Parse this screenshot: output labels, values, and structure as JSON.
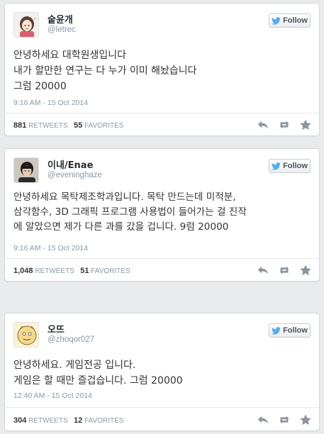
{
  "colors": {
    "background": "#e9eaeb",
    "twitter_blue": "#55acee",
    "text": "#333333",
    "muted": "#8899a6",
    "action_icon": "#8c959c"
  },
  "follow_label": "Follow",
  "tweets": [
    {
      "name": "숱윤개",
      "handle": "@letrec",
      "lines": [
        "안녕하세요 대학원생입니다",
        "내가 할만한 연구는 다 누가 이미 해놨습니다",
        "그럼 20000"
      ],
      "time": "9:16 AM - 15 Oct 2014",
      "retweets": "881",
      "retweets_label": "RETWEETS",
      "favorites": "55",
      "favorites_label": "FAVORITES",
      "avatar_icon": "cartoon-girl-avatar"
    },
    {
      "name": "이내/Enae",
      "handle": "@eveninghaze",
      "lines": [
        "안녕하세요 목탁제조학과입니다. 목탁 만드는데 미적분,",
        "삼각함수, 3D 그래픽 프로그램 사용법이 들어가는 걸 진작",
        "에 알았으면 제가 다른 과를 갔을 겁니다. 9럼 20000"
      ],
      "time": "9:16 AM - 15 Oct 2014",
      "retweets": "1,048",
      "retweets_label": "RETWEETS",
      "favorites": "51",
      "favorites_label": "FAVORITES",
      "avatar_icon": "person-photo-avatar"
    },
    {
      "name": "오뜨",
      "handle": "@zhoqor027",
      "lines": [
        "안녕하세요. 게임전공 입니다.",
        "게임은 할 때만 즐겁습니다. 그럼 20000"
      ],
      "time": "12:40 AM - 15 Oct 2014",
      "retweets": "304",
      "retweets_label": "RETWEETS",
      "favorites": "12",
      "favorites_label": "FAVORITES",
      "avatar_icon": "drawn-character-avatar"
    }
  ]
}
